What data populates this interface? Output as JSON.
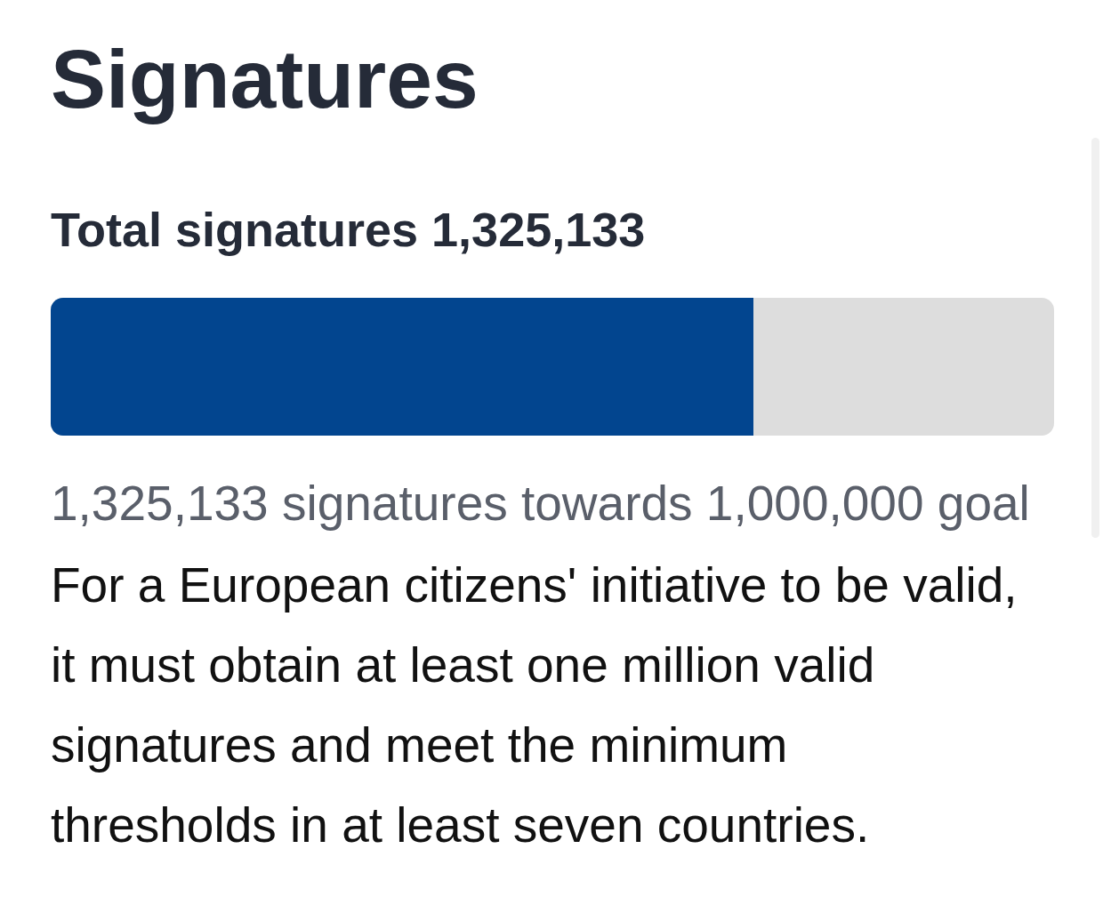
{
  "heading": "Signatures",
  "total": "Total signatures 1,325,133",
  "progress": {
    "level": 0.7
  },
  "goal_text": "1,325,133 signatures towards 1,000,000 goal",
  "description": "For a European citizens' initiative to be valid, it must obtain at least one million valid signatures and meet the minimum thresholds in at least seven countries."
}
